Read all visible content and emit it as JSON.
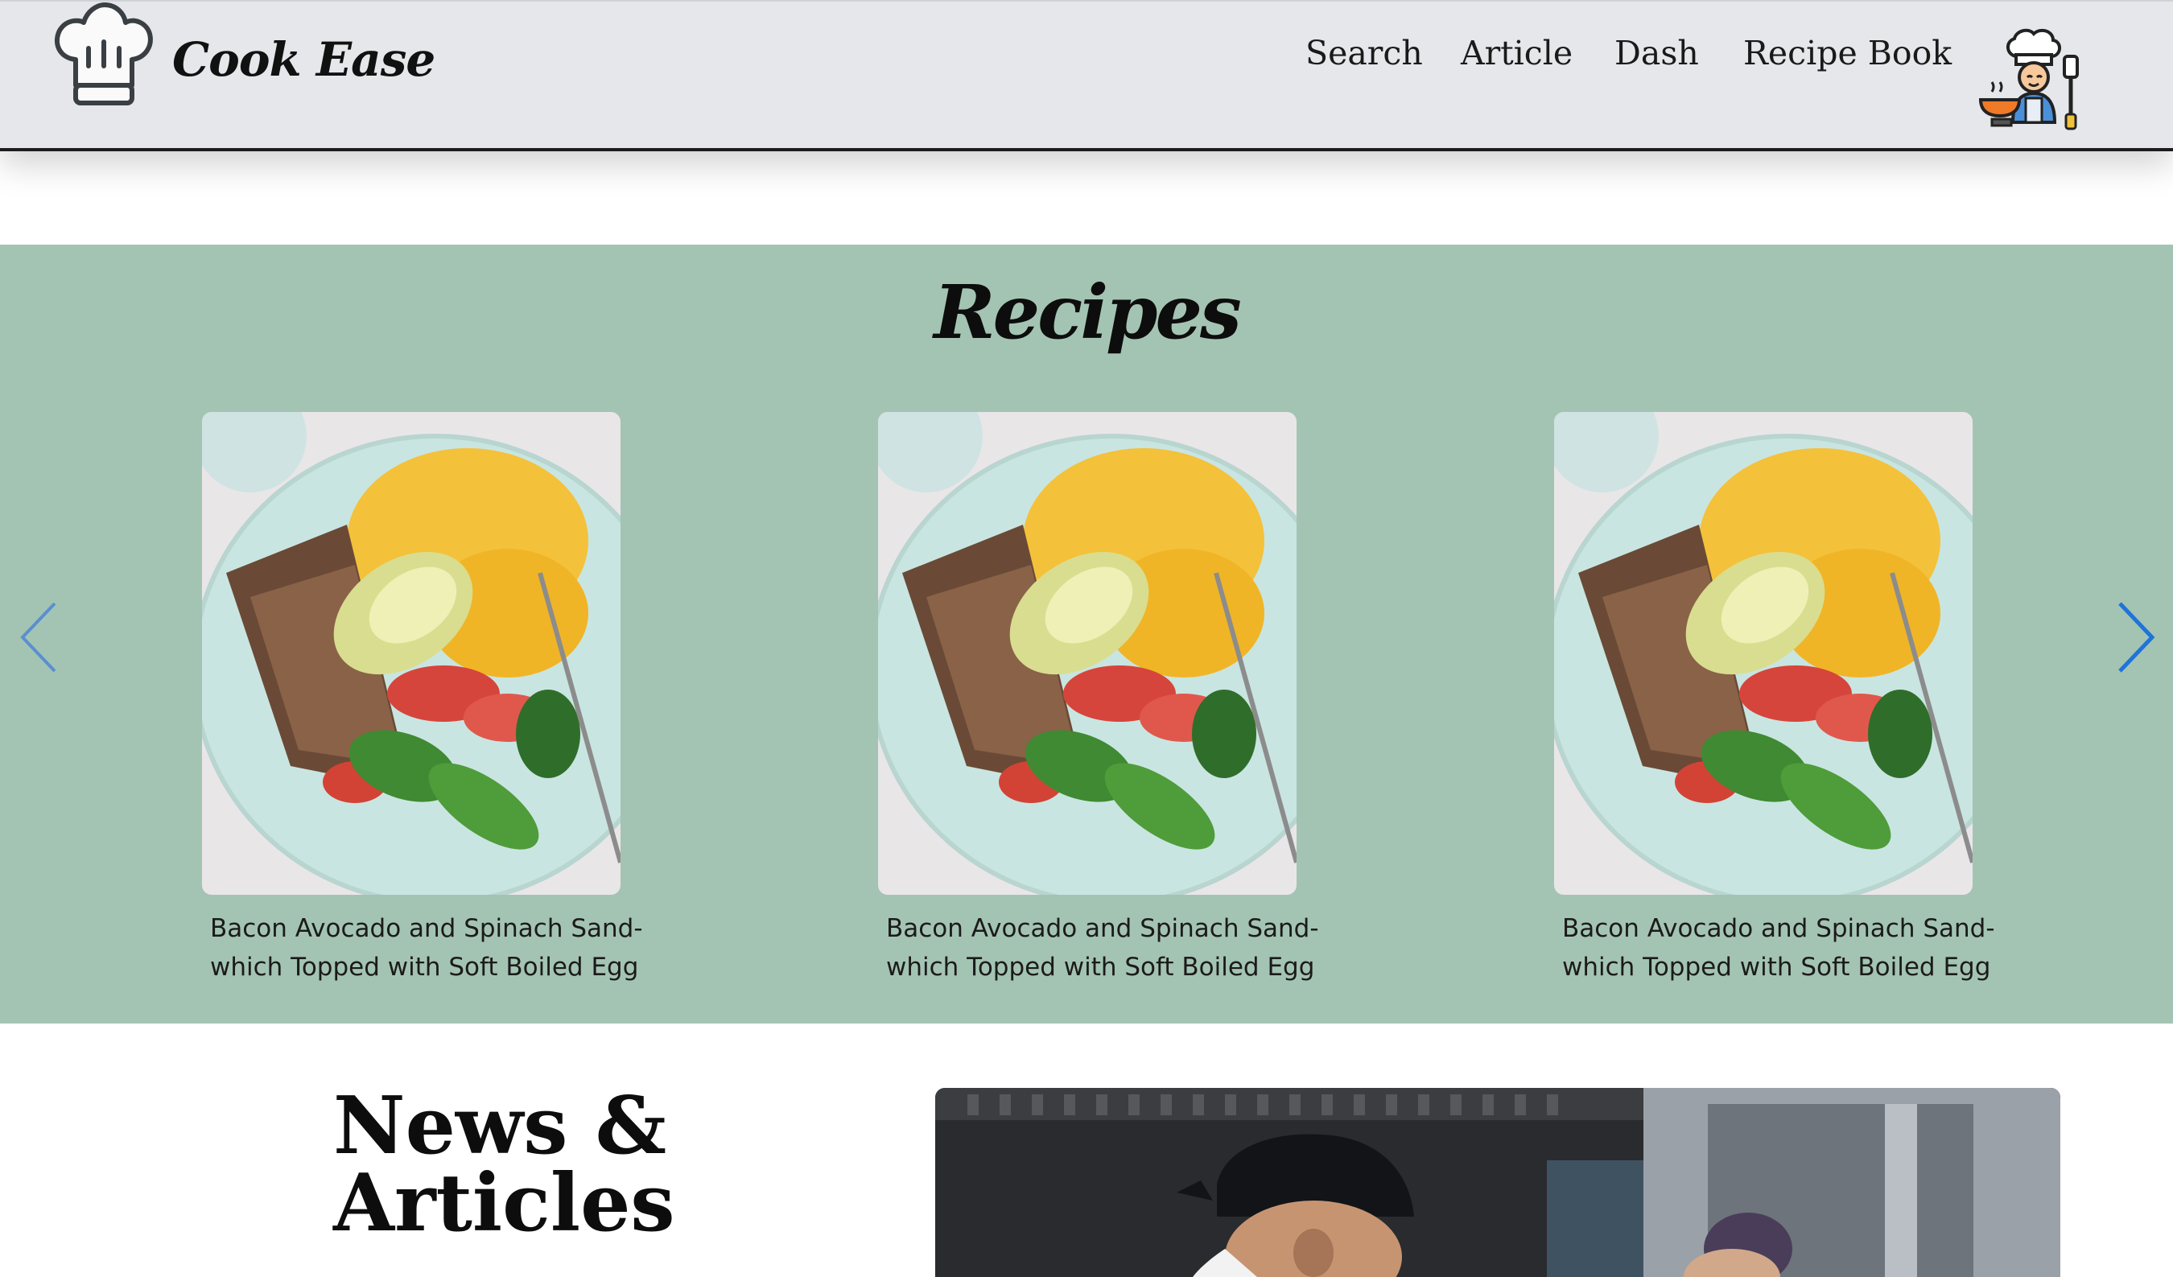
{
  "header": {
    "brand": "Cook Ease",
    "nav": [
      {
        "label": "Search"
      },
      {
        "label": "Article"
      },
      {
        "label": "Dash"
      },
      {
        "label": "Recipe Book"
      }
    ]
  },
  "recipes": {
    "title": "Recipes",
    "cards": [
      {
        "caption": "Bacon Avocado and Spinach Sand-which Topped with Soft Boiled Egg"
      },
      {
        "caption": "Bacon Avocado and Spinach Sand-which Topped with Soft Boiled Egg"
      },
      {
        "caption": "Bacon Avocado and Spinach Sand-which Topped with Soft Boiled Egg"
      }
    ],
    "arrow_color": "#1e74d9"
  },
  "news": {
    "title": "News & Articles"
  },
  "colors": {
    "header_bg": "#e5e7ea",
    "section_bg": "#a4c4b3"
  }
}
